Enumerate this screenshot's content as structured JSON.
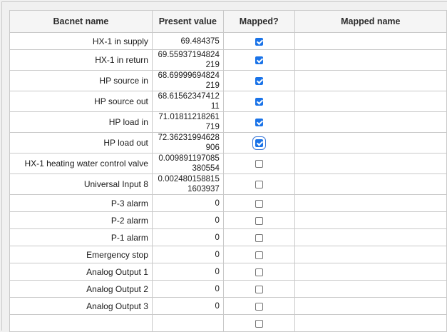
{
  "table": {
    "headers": {
      "name": "Bacnet name",
      "value": "Present value",
      "mapped": "Mapped?",
      "mapped_name": "Mapped name"
    },
    "rows": [
      {
        "name": "HX-1 in supply",
        "value": "69.484375",
        "mapped": true,
        "mapped_name": ""
      },
      {
        "name": "HX-1 in return",
        "value": "69.55937194824\n219",
        "mapped": true,
        "mapped_name": ""
      },
      {
        "name": "HP source in",
        "value": "68.69999694824\n219",
        "mapped": true,
        "mapped_name": ""
      },
      {
        "name": "HP source out",
        "value": "68.61562347412\n11",
        "mapped": true,
        "mapped_name": ""
      },
      {
        "name": "HP load in",
        "value": "71.01811218261\n719",
        "mapped": true,
        "mapped_name": ""
      },
      {
        "name": "HP load out",
        "value": "72.36231994628\n906",
        "mapped": true,
        "focused": true,
        "mapped_name": ""
      },
      {
        "name": "HX-1 heating water control valve",
        "value": "0.009891197085\n380554",
        "mapped": false,
        "mapped_name": ""
      },
      {
        "name": "Universal Input 8",
        "value": "0.002480158815\n1603937",
        "mapped": false,
        "mapped_name": ""
      },
      {
        "name": "P-3 alarm",
        "value": "0",
        "mapped": false,
        "mapped_name": ""
      },
      {
        "name": "P-2 alarm",
        "value": "0",
        "mapped": false,
        "mapped_name": ""
      },
      {
        "name": "P-1 alarm",
        "value": "0",
        "mapped": false,
        "mapped_name": ""
      },
      {
        "name": "Emergency stop",
        "value": "0",
        "mapped": false,
        "mapped_name": ""
      },
      {
        "name": "Analog Output 1",
        "value": "0",
        "mapped": false,
        "mapped_name": ""
      },
      {
        "name": "Analog Output 2",
        "value": "0",
        "mapped": false,
        "mapped_name": ""
      },
      {
        "name": "Analog Output 3",
        "value": "0",
        "mapped": false,
        "mapped_name": ""
      },
      {
        "name": "",
        "value": "",
        "mapped": false,
        "mapped_name": ""
      }
    ]
  },
  "colors": {
    "check_accent": "#1a73e8",
    "grid_border": "#c9c9c9"
  }
}
